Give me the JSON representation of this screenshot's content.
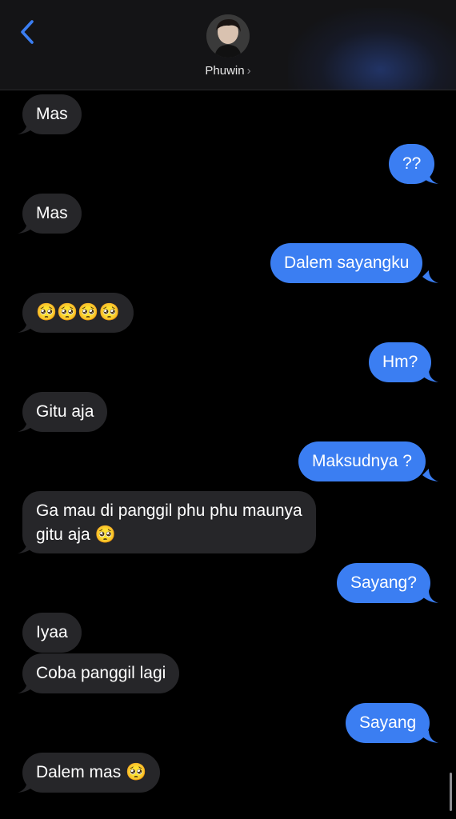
{
  "header": {
    "contact_name": "Phuwin",
    "chevron": "›",
    "back_icon": "chevron-left-icon"
  },
  "colors": {
    "sent_bubble": "#3b7ef2",
    "received_bubble": "#262629",
    "background": "#000000",
    "accent": "#3b7ef2"
  },
  "messages": [
    {
      "from": "contact",
      "text": "Mas"
    },
    {
      "from": "me",
      "text": "??"
    },
    {
      "from": "contact",
      "text": "Mas"
    },
    {
      "from": "me",
      "text": "Dalem sayangku"
    },
    {
      "from": "contact",
      "text": "🥺🥺🥺🥺"
    },
    {
      "from": "me",
      "text": "Hm?"
    },
    {
      "from": "contact",
      "text": "Gitu aja"
    },
    {
      "from": "me",
      "text": "Maksudnya ?"
    },
    {
      "from": "contact",
      "line1": "Ga mau di panggil phu phu maunya",
      "line2": "gitu aja 🥺"
    },
    {
      "from": "me",
      "text": "Sayang?"
    },
    {
      "from": "contact",
      "text": "Iyaa"
    },
    {
      "from": "contact",
      "text": "Coba panggil lagi"
    },
    {
      "from": "me",
      "text": "Sayang"
    },
    {
      "from": "contact",
      "text": "Dalem mas 🥺"
    }
  ]
}
